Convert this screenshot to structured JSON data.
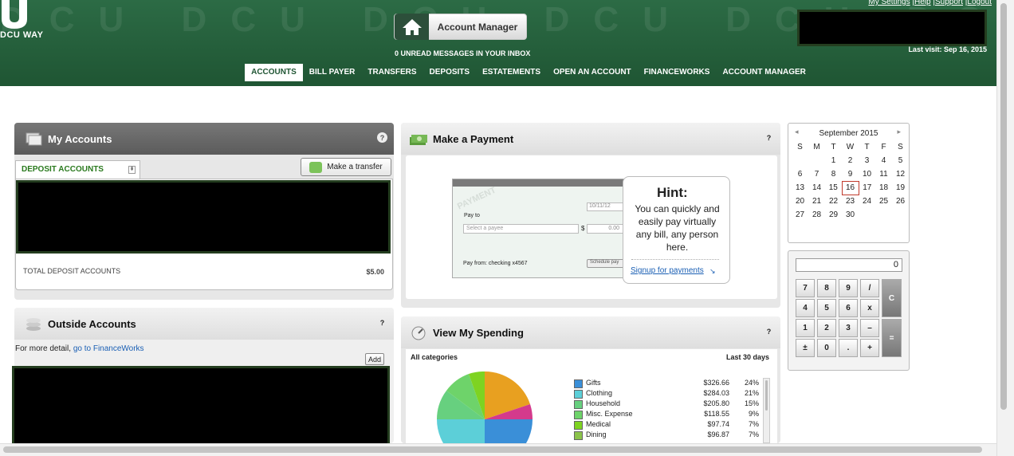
{
  "header": {
    "logo_text": "DCU WAY",
    "top_links": [
      "My Settings",
      "Help",
      "Support",
      "Logout"
    ],
    "account_manager_label": "Account Manager",
    "inbox_text": "0 UNREAD MESSAGES IN YOUR INBOX",
    "last_visit": "Last visit: Sep 16, 2015"
  },
  "menu": [
    {
      "label": "ACCOUNTS",
      "active": true
    },
    {
      "label": "BILL PAYER"
    },
    {
      "label": "TRANSFERS"
    },
    {
      "label": "DEPOSITS"
    },
    {
      "label": "ESTATEMENTS"
    },
    {
      "label": "OPEN AN ACCOUNT"
    },
    {
      "label": "FINANCEWORKS"
    },
    {
      "label": "ACCOUNT MANAGER"
    }
  ],
  "my_accounts": {
    "title": "My Accounts",
    "help": "?",
    "tab": "DEPOSIT ACCOUNTS",
    "transfer_button": "Make a transfer",
    "total_label": "TOTAL DEPOSIT ACCOUNTS",
    "total_value": "$5.00"
  },
  "outside_accounts": {
    "title": "Outside Accounts",
    "help": "?",
    "detail_prefix": "For more detail,",
    "detail_link": "go to FinanceWorks",
    "add_button": "Add"
  },
  "make_payment": {
    "title": "Make a Payment",
    "help": "?",
    "check": {
      "watermark": "PAYMENT",
      "date": "10/11/12",
      "pay_to_label": "Pay to",
      "payee_placeholder": "Select a payee",
      "dollar": "$",
      "amount": "0.00",
      "pay_from": "Pay from: checking x4567",
      "schedule_button": "Schedule pay"
    },
    "hint": {
      "title": "Hint:",
      "body": "You can quickly and easily pay virtually any bill, any person here.",
      "link": "Signup for payments"
    }
  },
  "view_spending": {
    "title": "View My Spending",
    "help": "?",
    "filter": "All categories",
    "period": "Last 30 days",
    "categories": [
      {
        "name": "Gifts",
        "amount": "$326.66",
        "pct": "24%",
        "color": "#3a8fd8"
      },
      {
        "name": "Clothing",
        "amount": "$284.03",
        "pct": "21%",
        "color": "#5ccfd8"
      },
      {
        "name": "Household",
        "amount": "$205.80",
        "pct": "15%",
        "color": "#67d07f"
      },
      {
        "name": "Misc. Expense",
        "amount": "$118.55",
        "pct": "9%",
        "color": "#6ed36a"
      },
      {
        "name": "Medical",
        "amount": "$97.74",
        "pct": "7%",
        "color": "#7ed321"
      },
      {
        "name": "Dining",
        "amount": "$96.87",
        "pct": "7%",
        "color": "#8bc34a"
      }
    ]
  },
  "calendar": {
    "month": "September 2015",
    "prev": "◂",
    "next": "▸",
    "weekdays": [
      "S",
      "M",
      "T",
      "W",
      "T",
      "F",
      "S"
    ],
    "weeks": [
      [
        "",
        "",
        "1",
        "2",
        "3",
        "4",
        "5"
      ],
      [
        "6",
        "7",
        "8",
        "9",
        "10",
        "11",
        "12"
      ],
      [
        "13",
        "14",
        "15",
        "16",
        "17",
        "18",
        "19"
      ],
      [
        "20",
        "21",
        "22",
        "23",
        "24",
        "25",
        "26"
      ],
      [
        "27",
        "28",
        "29",
        "30",
        "",
        "",
        ""
      ]
    ],
    "today": "16"
  },
  "calculator": {
    "display": "0",
    "keys": [
      [
        "7",
        "8",
        "9",
        "/"
      ],
      [
        "4",
        "5",
        "6",
        "x"
      ],
      [
        "1",
        "2",
        "3",
        "–"
      ],
      [
        "±",
        "0",
        ".",
        "+"
      ]
    ],
    "clear": "C",
    "equals": "="
  }
}
